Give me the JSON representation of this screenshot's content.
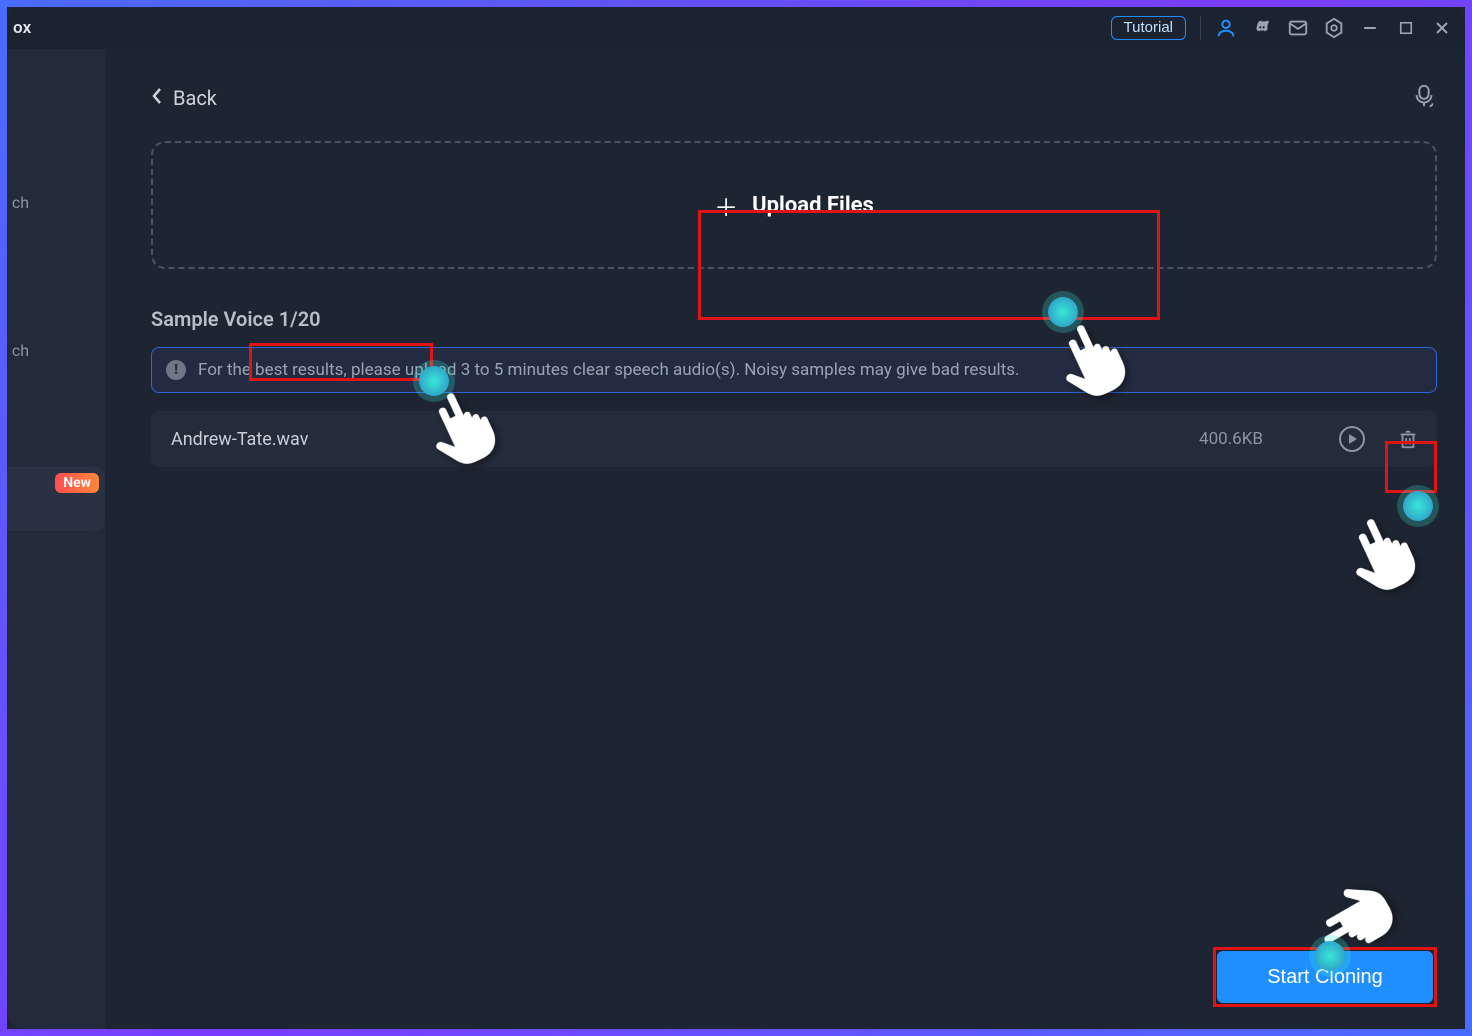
{
  "titlebar": {
    "title_fragment": "ox",
    "tutorial_label": "Tutorial"
  },
  "sidebar": {
    "items": [
      {
        "label": "ch"
      },
      {
        "label": "ch"
      },
      {
        "label": ""
      }
    ],
    "new_badge": "New"
  },
  "back_label": "Back",
  "upload": {
    "label": "Upload Files"
  },
  "sample": {
    "heading": "Sample Voice 1/20",
    "info": "For the best results, please upload 3 to 5 minutes clear speech audio(s). Noisy samples may give bad results."
  },
  "files": [
    {
      "name": "Andrew-Tate.wav",
      "size": "400.6KB"
    }
  ],
  "start_label": "Start Cloning"
}
